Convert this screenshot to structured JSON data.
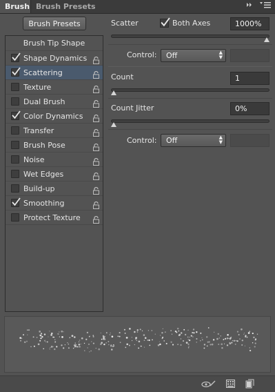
{
  "tabs": [
    {
      "label": "Brush",
      "active": true
    },
    {
      "label": "Brush Presets",
      "active": false
    }
  ],
  "brush_presets_button": "Brush Presets",
  "options": [
    {
      "label": "Brush Tip Shape",
      "header": true
    },
    {
      "label": "Shape Dynamics",
      "checked": true
    },
    {
      "label": "Scattering",
      "checked": true,
      "selected": true
    },
    {
      "label": "Texture",
      "checked": false
    },
    {
      "label": "Dual Brush",
      "checked": false
    },
    {
      "label": "Color Dynamics",
      "checked": true
    },
    {
      "label": "Transfer",
      "checked": false
    },
    {
      "label": "Brush Pose",
      "checked": false
    },
    {
      "label": "Noise",
      "checked": false
    },
    {
      "label": "Wet Edges",
      "checked": false
    },
    {
      "label": "Build-up",
      "checked": false
    },
    {
      "label": "Smoothing",
      "checked": true
    },
    {
      "label": "Protect Texture",
      "checked": false
    }
  ],
  "scatter": {
    "label": "Scatter",
    "both_axes_label": "Both Axes",
    "both_axes_checked": true,
    "value": "1000%",
    "slider_fraction": 1.0,
    "control_label": "Control:",
    "control_value": "Off"
  },
  "count": {
    "label": "Count",
    "value": "1",
    "slider_fraction": 0.0
  },
  "count_jitter": {
    "label": "Count Jitter",
    "value": "0%",
    "slider_fraction": 0.0,
    "control_label": "Control:",
    "control_value": "Off"
  },
  "colors": {
    "panel_bg": "#535353",
    "selected_row": "#4a5a6d",
    "field_bg": "#3a3a3a"
  }
}
